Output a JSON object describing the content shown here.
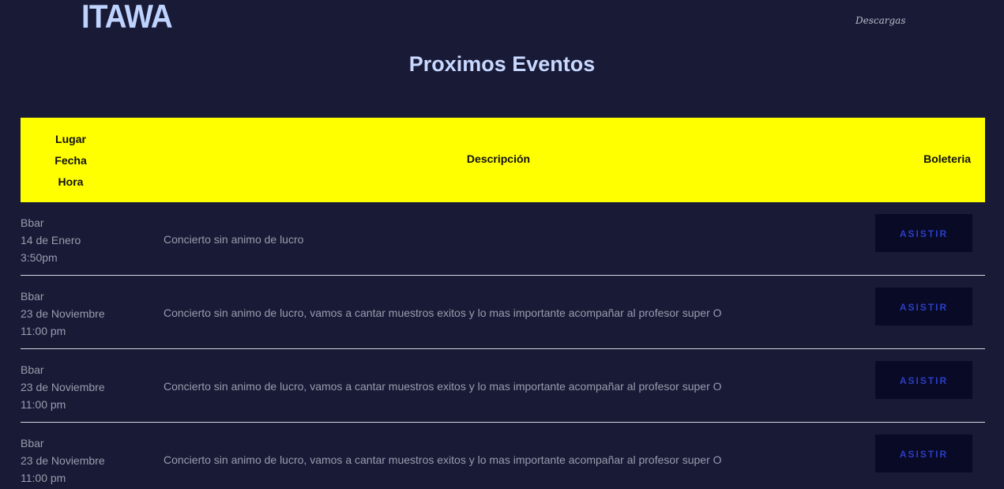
{
  "header": {
    "logo": "ITAWA",
    "nav_link": "Descargas"
  },
  "page_title": "Proximos Eventos",
  "table": {
    "columns": {
      "lugar": "Lugar",
      "fecha": "Fecha",
      "hora": "Hora",
      "description": "Descripción",
      "tickets": "Boleteria"
    },
    "rows": [
      {
        "lugar": "Bbar",
        "fecha": "14 de Enero",
        "hora": "3:50pm",
        "description": "Concierto sin animo de lucro",
        "button": "ASISTIR"
      },
      {
        "lugar": "Bbar",
        "fecha": "23 de Noviembre",
        "hora": "11:00 pm",
        "description": "Concierto sin animo de lucro, vamos a cantar muestros exitos y lo mas importante acompañar al profesor super O",
        "button": "ASISTIR"
      },
      {
        "lugar": "Bbar",
        "fecha": "23 de Noviembre",
        "hora": "11:00 pm",
        "description": "Concierto sin animo de lucro, vamos a cantar muestros exitos y lo mas importante acompañar al profesor super O",
        "button": "ASISTIR"
      },
      {
        "lugar": "Bbar",
        "fecha": "23 de Noviembre",
        "hora": "11:00 pm",
        "description": "Concierto sin animo de lucro, vamos a cantar muestros exitos y lo mas importante acompañar al profesor super O",
        "button": "ASISTIR"
      }
    ]
  },
  "colors": {
    "background": "#181a36",
    "header_band": "#ffff00",
    "title": "#c8d8ff",
    "button_bg": "#090a26",
    "button_text": "#2b3ec8"
  }
}
